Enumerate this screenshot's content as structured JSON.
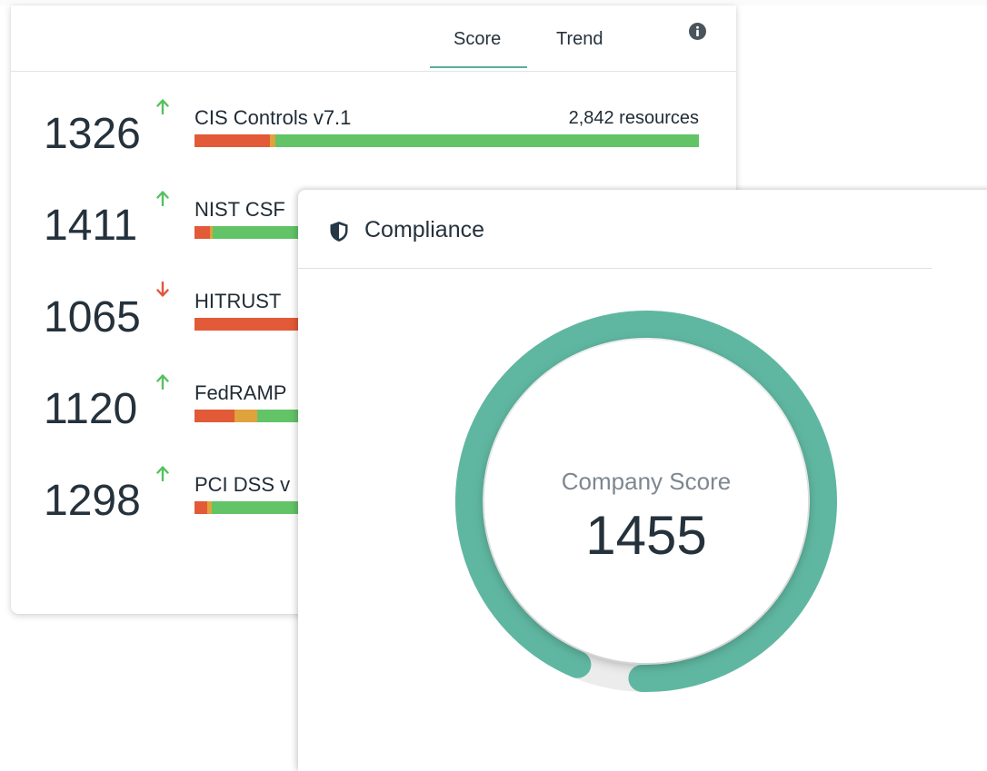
{
  "tabs": [
    {
      "label": "Score",
      "active": true
    },
    {
      "label": "Trend",
      "active": false
    }
  ],
  "frameworks": [
    {
      "score": "1326",
      "trend": "up",
      "name": "CIS Controls v7.1",
      "resources": "2,842 resources",
      "bar": [
        {
          "color": "#e25a37",
          "value": 15
        },
        {
          "color": "#e0a23c",
          "value": 1
        },
        {
          "color": "#62c467",
          "value": 84
        }
      ]
    },
    {
      "score": "1411",
      "trend": "up",
      "name": "NIST CSF",
      "bar": [
        {
          "color": "#e25a37",
          "value": 3
        },
        {
          "color": "#e0a23c",
          "value": 0.6
        },
        {
          "color": "#62c467",
          "value": 96.4
        }
      ]
    },
    {
      "score": "1065",
      "trend": "down",
      "name": "HITRUST",
      "bar": [
        {
          "color": "#e25a37",
          "value": 100
        }
      ]
    },
    {
      "score": "1120",
      "trend": "up",
      "name": "FedRAMP",
      "bar": [
        {
          "color": "#e25a37",
          "value": 8
        },
        {
          "color": "#e0a23c",
          "value": 4.5
        },
        {
          "color": "#62c467",
          "value": 87.5
        }
      ]
    },
    {
      "score": "1298",
      "trend": "up",
      "name": "PCI DSS v",
      "bar": [
        {
          "color": "#e25a37",
          "value": 2.5
        },
        {
          "color": "#e0a23c",
          "value": 1
        },
        {
          "color": "#62c467",
          "value": 96.5
        }
      ]
    }
  ],
  "compliance": {
    "title": "Compliance",
    "score_label": "Company Score",
    "score": "1455",
    "gauge_fraction": 0.94,
    "gauge_color": "#5fb7a1",
    "track_color": "#ececec"
  },
  "colors": {
    "up": "#56c15e",
    "down": "#e2553a"
  },
  "icons": {
    "info": "info-icon",
    "shield": "shield-icon",
    "trend_up": "arrow-up-icon",
    "trend_down": "arrow-down-icon"
  }
}
